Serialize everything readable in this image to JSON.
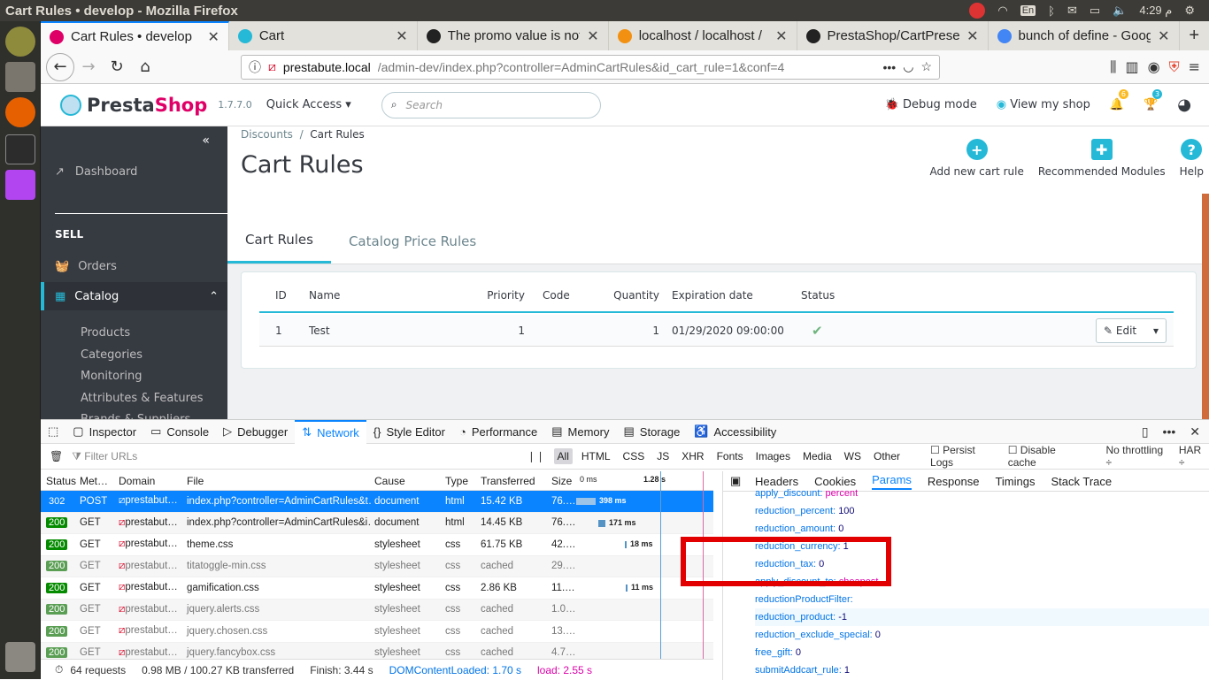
{
  "topbar": {
    "window_title": "Cart Rules • develop - Mozilla Firefox",
    "kbd": "En",
    "time": "4:29 م"
  },
  "browser": {
    "tabs": [
      {
        "label": "Cart Rules • develop",
        "favicon_color": "#df0067"
      },
      {
        "label": "Cart",
        "favicon_color": "#25b9d7"
      },
      {
        "label": "The promo value is not",
        "favicon_color": "#222222"
      },
      {
        "label": "localhost / localhost /",
        "favicon_color": "#f29111"
      },
      {
        "label": "PrestaShop/CartPrese",
        "favicon_color": "#222222"
      },
      {
        "label": "bunch of define - Goog",
        "favicon_color": "#4285f4"
      }
    ],
    "url_host": "prestabute.local",
    "url_path": "/admin-dev/index.php?controller=AdminCartRules&id_cart_rule=1&conf=4"
  },
  "ps": {
    "logo_a": "Presta",
    "logo_b": "Shop",
    "version": "1.7.7.0",
    "quick_access": "Quick Access",
    "search_placeholder": "Search",
    "debug": "Debug mode",
    "view_shop": "View my shop",
    "notif_count": "6",
    "trophy_count": "3"
  },
  "sidebar": {
    "dashboard": "Dashboard",
    "sell": "SELL",
    "orders": "Orders",
    "catalog": "Catalog",
    "subitems": [
      "Products",
      "Categories",
      "Monitoring",
      "Attributes & Features",
      "Brands & Suppliers"
    ]
  },
  "page": {
    "bread_parent": "Discounts",
    "bread_current": "Cart Rules",
    "title": "Cart Rules",
    "buttons": {
      "add": "Add new cart rule",
      "modules": "Recommended Modules",
      "help": "Help"
    },
    "tabs": [
      "Cart Rules",
      "Catalog Price Rules"
    ],
    "table": {
      "headers": {
        "id": "ID",
        "name": "Name",
        "priority": "Priority",
        "code": "Code",
        "quantity": "Quantity",
        "expiration": "Expiration date",
        "status": "Status"
      },
      "row": {
        "id": "1",
        "name": "Test",
        "priority": "1",
        "code": "",
        "quantity": "1",
        "expiration": "01/29/2020 09:00:00",
        "edit": "Edit"
      }
    }
  },
  "devtools": {
    "tabs": [
      "Inspector",
      "Console",
      "Debugger",
      "Network",
      "Style Editor",
      "Performance",
      "Memory",
      "Storage",
      "Accessibility"
    ],
    "filter_placeholder": "Filter URLs",
    "filters": [
      "All",
      "HTML",
      "CSS",
      "JS",
      "XHR",
      "Fonts",
      "Images",
      "Media",
      "WS",
      "Other"
    ],
    "persist": "Persist Logs",
    "disable_cache": "Disable cache",
    "throttle": "No throttling ÷",
    "har": "HAR ÷",
    "columns": {
      "status": "Status",
      "method": "Met…",
      "domain": "Domain",
      "file": "File",
      "cause": "Cause",
      "type": "Type",
      "transferred": "Transferred",
      "size": "Size",
      "wf0": "0 ms",
      "wf1": "1.28 s"
    },
    "rows": [
      {
        "status": "302",
        "method": "POST",
        "domain": "prestabut…",
        "file": "index.php?controller=AdminCartRules&t…",
        "cause": "document",
        "type": "html",
        "transferred": "15.42 KB",
        "size": "76.…",
        "timing": "398 ms"
      },
      {
        "status": "200",
        "method": "GET",
        "domain": "prestabut…",
        "file": "index.php?controller=AdminCartRules&i…",
        "cause": "document",
        "type": "html",
        "transferred": "14.45 KB",
        "size": "76.…",
        "timing": "171 ms"
      },
      {
        "status": "200",
        "method": "GET",
        "domain": "prestabut…",
        "file": "theme.css",
        "cause": "stylesheet",
        "type": "css",
        "transferred": "61.75 KB",
        "size": "42.…",
        "timing": "18 ms"
      },
      {
        "status": "200",
        "method": "GET",
        "domain": "prestabut…",
        "file": "titatoggle-min.css",
        "cause": "stylesheet",
        "type": "css",
        "transferred": "cached",
        "size": "29.…",
        "timing": ""
      },
      {
        "status": "200",
        "method": "GET",
        "domain": "prestabut…",
        "file": "gamification.css",
        "cause": "stylesheet",
        "type": "css",
        "transferred": "2.86 KB",
        "size": "11.…",
        "timing": "11 ms"
      },
      {
        "status": "200",
        "method": "GET",
        "domain": "prestabut…",
        "file": "jquery.alerts.css",
        "cause": "stylesheet",
        "type": "css",
        "transferred": "cached",
        "size": "1.0…",
        "timing": ""
      },
      {
        "status": "200",
        "method": "GET",
        "domain": "prestabut…",
        "file": "jquery.chosen.css",
        "cause": "stylesheet",
        "type": "css",
        "transferred": "cached",
        "size": "13.…",
        "timing": ""
      },
      {
        "status": "200",
        "method": "GET",
        "domain": "prestabut…",
        "file": "jquery.fancybox.css",
        "cause": "stylesheet",
        "type": "css",
        "transferred": "cached",
        "size": "4.7…",
        "timing": ""
      }
    ],
    "status": {
      "requests": "64 requests",
      "transferred": "0.98 MB / 100.27 KB transferred",
      "finish": "Finish: 3.44 s",
      "dom": "DOMContentLoaded: 1.70 s",
      "load": "load: 2.55 s"
    },
    "panel_tabs": [
      "Headers",
      "Cookies",
      "Params",
      "Response",
      "Timings",
      "Stack Trace"
    ],
    "params": [
      {
        "k": "apply_discount:",
        "v": "percent",
        "num": false
      },
      {
        "k": "reduction_percent:",
        "v": "100",
        "num": true
      },
      {
        "k": "reduction_amount:",
        "v": "0",
        "num": true
      },
      {
        "k": "reduction_currency:",
        "v": "1",
        "num": true
      },
      {
        "k": "reduction_tax:",
        "v": "0",
        "num": true
      },
      {
        "k": "apply_discount_to:",
        "v": "cheapest",
        "num": false
      },
      {
        "k": "reductionProductFilter:",
        "v": "",
        "num": false
      },
      {
        "k": "reduction_product:",
        "v": "-1",
        "num": true
      },
      {
        "k": "reduction_exclude_special:",
        "v": "0",
        "num": true
      },
      {
        "k": "free_gift:",
        "v": "0",
        "num": true
      },
      {
        "k": "submitAddcart_rule:",
        "v": "1",
        "num": true
      }
    ]
  }
}
